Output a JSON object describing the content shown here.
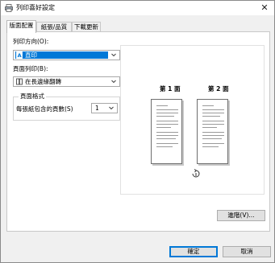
{
  "window": {
    "title": "列印喜好設定",
    "close_glyph": "✕"
  },
  "tabs": [
    {
      "label": "版面配置",
      "active": true
    },
    {
      "label": "紙張/品質",
      "active": false
    },
    {
      "label": "下載更新",
      "active": false
    }
  ],
  "layout": {
    "orientation_label": "列印方向(O):",
    "orientation_value": "直印",
    "page_order_label": "頁面列印(B):",
    "page_order_value": "在長邊緣翻轉",
    "page_format_group": "頁面格式",
    "pages_per_sheet_label": "每張紙包含的頁數(S)",
    "pages_per_sheet_value": "1"
  },
  "preview": {
    "page1_label": "第 1 面",
    "page2_label": "第 2 面",
    "flip_icon": "flip-long-edge-icon"
  },
  "buttons": {
    "advanced": "進階(V)...",
    "ok": "確定",
    "cancel": "取消"
  },
  "colors": {
    "selection": "#0078d7",
    "default_button_border": "#0078d7"
  }
}
